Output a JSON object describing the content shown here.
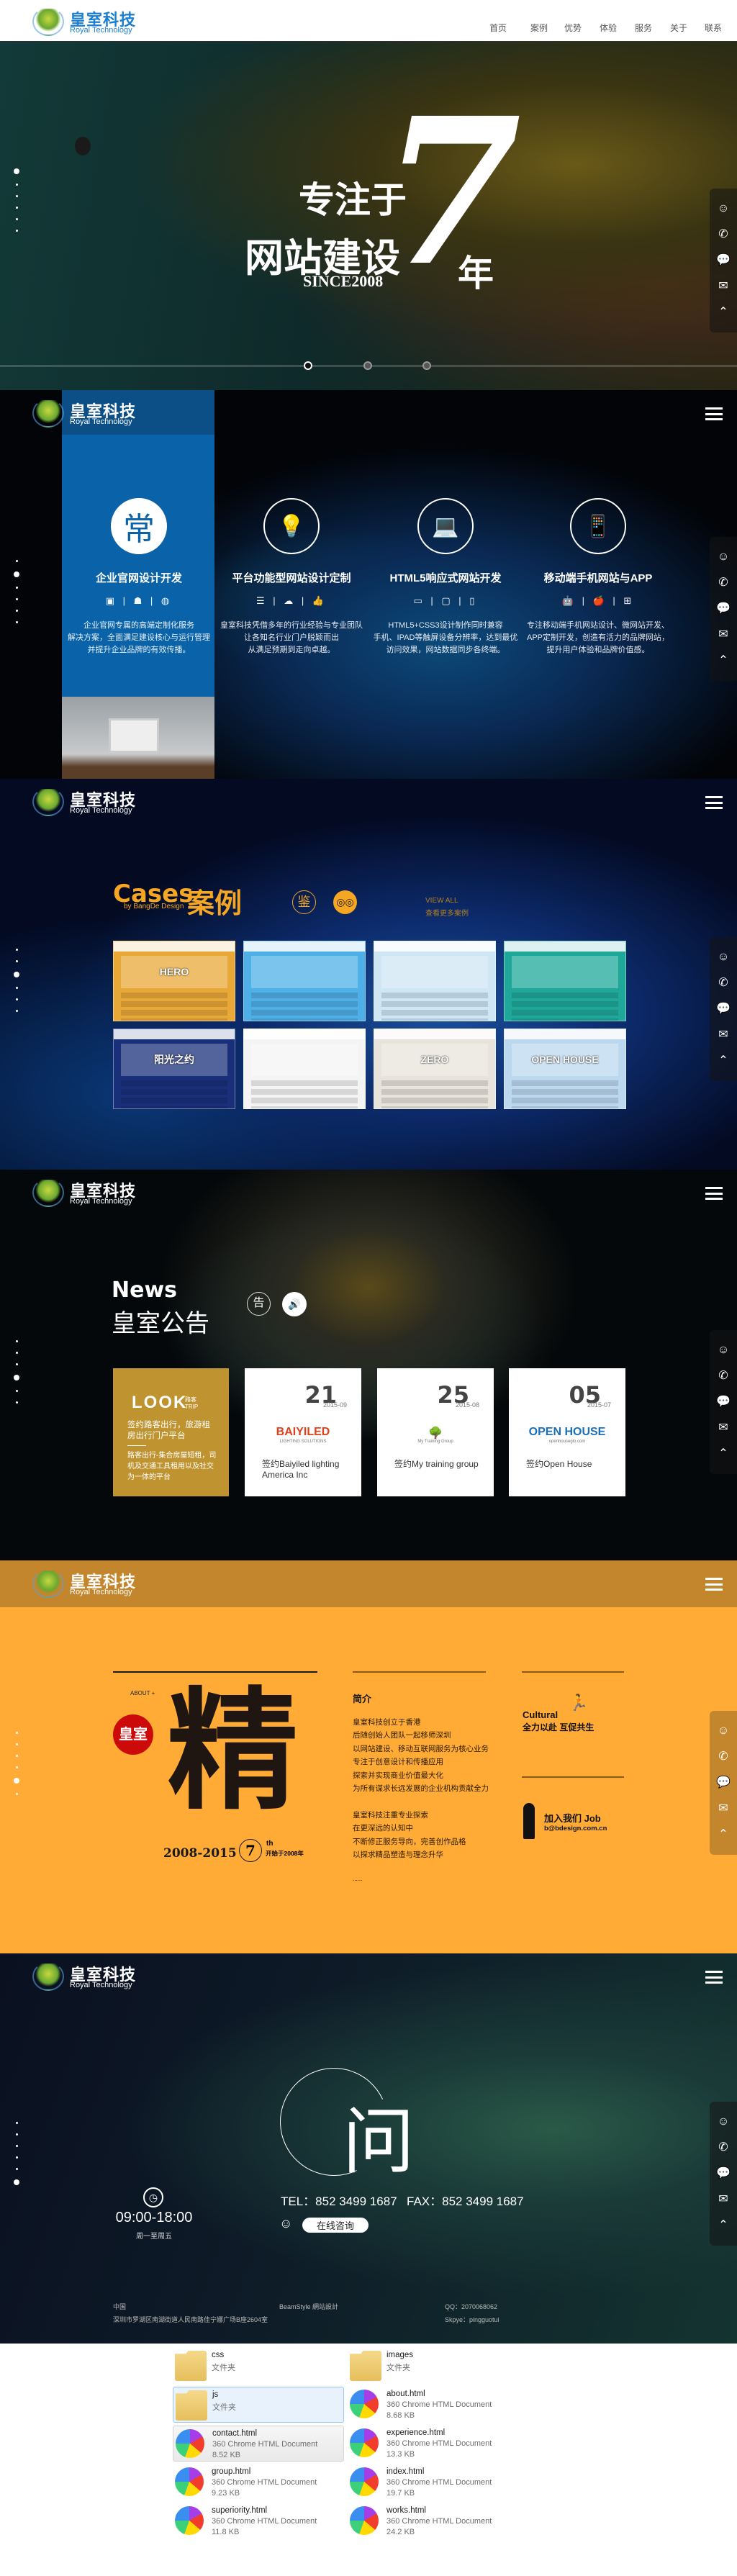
{
  "header": {
    "logo_cn": "皇室科技",
    "logo_en": "Royal Technology",
    "nav": [
      "首页",
      "案例",
      "优势",
      "体验",
      "服务",
      "关于",
      "联系"
    ]
  },
  "side_tools": [
    "qq-icon",
    "phone-icon",
    "wechat-icon",
    "mail-icon",
    "back-to-top-icon"
  ],
  "hero": {
    "line1": "专注于",
    "line2": "网站建设",
    "big": "7",
    "year": "年",
    "since": "SINCE2008"
  },
  "services": {
    "items": [
      {
        "badge": "常",
        "icon": "chang-badge",
        "title": "企业官网设计开发",
        "icons": "▣ | ☗ | ◍",
        "desc": [
          "企业官网专属的高端定制化服务",
          "解决方案，全面满足建设核心与运行管理",
          "并提升企业品牌的有效传播。"
        ]
      },
      {
        "badge": "💡",
        "icon": "lightbulb-icon",
        "title": "平台功能型网站设计定制",
        "icons": "☰ | ☁ | 👍",
        "desc": [
          "皇室科技凭借多年的行业经验与专业团队",
          "让各知名行业门户脱颖而出",
          "从满足预期到走向卓越。"
        ]
      },
      {
        "badge": "💻",
        "icon": "laptop-icon",
        "title": "HTML5响应式网站开发",
        "icons": "▭ | ▢ | ▯",
        "desc": [
          "HTML5+CSS3设计制作同时兼容",
          "手机、IPAD等触屏设备分辨率，达到最优",
          "访问效果，网站数据同步各终端。"
        ]
      },
      {
        "badge": "📱",
        "icon": "phone-device-icon",
        "title": "移动端手机网站与APP",
        "icons": "🤖 | 🍎 | ⊞",
        "desc": [
          "专注移动端手机网站设计、微网站开发、",
          "APP定制开发，创造有活力的品牌网站，",
          "提升用户体验和品牌价值感。"
        ]
      }
    ]
  },
  "cases": {
    "title_en": "Cases",
    "title_cn": "案例",
    "by": "by BangDe Design",
    "badge": "鉴",
    "view_all": "VIEW ALL",
    "more": "查看更多案例",
    "thumbs": [
      {
        "color": "#e8a838",
        "label": "HERO"
      },
      {
        "color": "#4fb0e8",
        "label": ""
      },
      {
        "color": "#cfe6f5",
        "label": ""
      },
      {
        "color": "#1fa89a",
        "label": ""
      },
      {
        "color": "#1a2f7a",
        "label": "阳光之约"
      },
      {
        "color": "#f4f4f4",
        "label": ""
      },
      {
        "color": "#e8e4dc",
        "label": "ZERO"
      },
      {
        "color": "#bcd8ef",
        "label": "OPEN HOUSE"
      }
    ]
  },
  "news": {
    "title_en": "News",
    "title_cn": "皇室公告",
    "badge": "告",
    "featured": {
      "logo": "LOOK",
      "logo_sub": "路客 TRIP",
      "title": "签约路客出行，旅游租房出行门户平台",
      "desc": "路客出行-集合房屋短租，司机及交通工具租用以及社交为一体的平台",
      "color": "#bf9430"
    },
    "cards": [
      {
        "day": "21",
        "ym": "2015-09",
        "logo": "BAIYILED",
        "logo_sub": "LIGHTING SOLUTIONS",
        "logo_color": "#e0401c",
        "title": "签约Baiyiled lighting America Inc"
      },
      {
        "day": "25",
        "ym": "2015-08",
        "logo": "🌳",
        "logo_sub": "My Training Group",
        "logo_color": "#3aa0d8",
        "title": "签约My training group"
      },
      {
        "day": "05",
        "ym": "2015-07",
        "logo": "OPEN HOUSE",
        "logo_sub": "openhouseglo.com",
        "logo_color": "#1a70b8",
        "title": "签约Open House"
      }
    ]
  },
  "about": {
    "label": "ABOUT +",
    "badge": "皇室",
    "big": "精",
    "years": "2008-2015",
    "num": "7",
    "th": "th",
    "since": "开始于2008年",
    "intro_title": "简介",
    "p1": [
      "皇室科技创立于香港",
      "后随创始人团队一起移师深圳",
      "以网站建设、移动互联网服务为核心业务",
      "专注于创意设计和传播应用",
      "探索并实现商业价值最大化",
      "为所有谋求长远发展的企业机构贡献全力"
    ],
    "p2": [
      "皇室科技注重专业探索",
      "在更深远的认知中",
      "不断修正服务导向，完善创作品格",
      "以探求精品塑造与理念升华"
    ],
    "ellipsis": "......",
    "cultural": "Cultural",
    "cultural_cn": "全力以赴 互促共生",
    "job": "加入我们 Job",
    "email": "b@bdesign.com.cn",
    "bg": "#ffab36"
  },
  "contact": {
    "char": "问",
    "tel": "TEL：852 3499 1687",
    "fax": "FAX：852 3499 1687",
    "consult": "在线咨询",
    "hours": "09:00-18:00",
    "days": "周一至周五",
    "footer": {
      "country": "中国",
      "address": "深圳市罗湖区南湖街道人民南路佳宁娜广场B座2604室",
      "design": "BeamStyle 網站設計",
      "qq": "QQ：2070068062",
      "skype": "Skpye：pingguotui"
    }
  },
  "files": [
    {
      "name": "css",
      "type": "文件夹",
      "size": "",
      "kind": "folder"
    },
    {
      "name": "images",
      "type": "文件夹",
      "size": "",
      "kind": "folder"
    },
    {
      "name": "js",
      "type": "文件夹",
      "size": "",
      "kind": "folder",
      "state": "selected"
    },
    {
      "name": "about.html",
      "type": "360 Chrome HTML Document",
      "size": "8.68 KB",
      "kind": "html"
    },
    {
      "name": "contact.html",
      "type": "360 Chrome HTML Document",
      "size": "8.52 KB",
      "kind": "html",
      "state": "hover"
    },
    {
      "name": "experience.html",
      "type": "360 Chrome HTML Document",
      "size": "13.3 KB",
      "kind": "html"
    },
    {
      "name": "group.html",
      "type": "360 Chrome HTML Document",
      "size": "9.23 KB",
      "kind": "html"
    },
    {
      "name": "index.html",
      "type": "360 Chrome HTML Document",
      "size": "19.7 KB",
      "kind": "html"
    },
    {
      "name": "superiority.html",
      "type": "360 Chrome HTML Document",
      "size": "11.8 KB",
      "kind": "html"
    },
    {
      "name": "works.html",
      "type": "360 Chrome HTML Document",
      "size": "24.2 KB",
      "kind": "html"
    }
  ]
}
